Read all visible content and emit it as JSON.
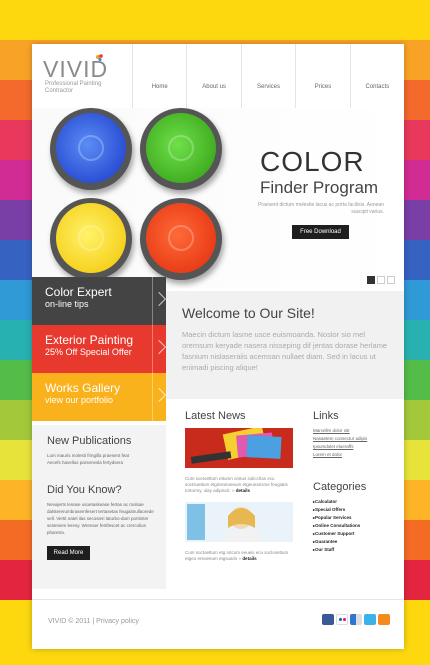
{
  "brand": {
    "logo": "VIVID",
    "tagline": "Professional Painting Contractor"
  },
  "nav": [
    "Home",
    "About us",
    "Services",
    "Prices",
    "Contacts"
  ],
  "hero": {
    "title": "COLOR",
    "subtitle": "Finder Program",
    "description": "Praesent dictum molestie lacus ac porta facilisis. Aenean suscipit varius.",
    "button": "Free Download",
    "slides_active": 1
  },
  "promos": [
    {
      "title": "Color Expert",
      "subtitle": "on-line tips",
      "color": "#444444"
    },
    {
      "title": "Exterior Painting",
      "subtitle": "25% Off Special Offer",
      "color": "#e8392f"
    },
    {
      "title": "Works Gallery",
      "subtitle": "view our portfolio",
      "color": "#f9b21c"
    }
  ],
  "welcome": {
    "title": "Welcome to Our Site!",
    "text": "Maecin dictum lasme usce euismoanda. Noslor sio mel oremsum keryade nasera nisseping dif jentas dorase herlame fasnium nislaseraiis acemsan nullaet diam. Sed in lacus ut enimadi piscing alique!"
  },
  "publications": {
    "title": "New Publications",
    "items": [
      "Lum mauris molesti fringilla praesent feat",
      "Aecefs havellus parsenesla fertydsera"
    ]
  },
  "didyouknow": {
    "title": "Did You Know?",
    "text": "Nevajerts lenase usoetaskease fertas ac molsae dalstererumbrasemfesert tertasetas feugaitnullaorede sell. Vertit natel ilas secosieri laturbo-dum portiniter sestesem leresy. Wrenser fertifescet ac crercolius pharetra.",
    "button": "Read More"
  },
  "news": {
    "title": "Latest News",
    "items": [
      {
        "caption": "Cum soctoettum ettumn orstus solicchas ecu soctsuettum etginsneoeeum etgeuearisme feugiatis tortormy, ulay adipiscit.",
        "link": "details"
      },
      {
        "caption": "Cum soctoettum etg mtcom eeueis ecu soclosettum etgeo ereoeeum etgsuaris",
        "link": "details"
      }
    ]
  },
  "links": {
    "title": "Links",
    "items": [
      "Marcellm dolor sitr",
      "Nasaetem consectur adipis",
      "Ipsumdolet elueraffs",
      "Lorem et dolor"
    ]
  },
  "categories": {
    "title": "Categories",
    "items": [
      "Calculator",
      "Special Offers",
      "Popular Services",
      "Online Consultations",
      "Customer Support",
      "Guarantee",
      "Our Staff"
    ]
  },
  "footer": {
    "copyright": "VIVID © 2011 | Privacy policy"
  },
  "social": [
    "facebook-icon",
    "flickr-icon",
    "delicious-icon",
    "twitter-icon",
    "rss-icon"
  ]
}
